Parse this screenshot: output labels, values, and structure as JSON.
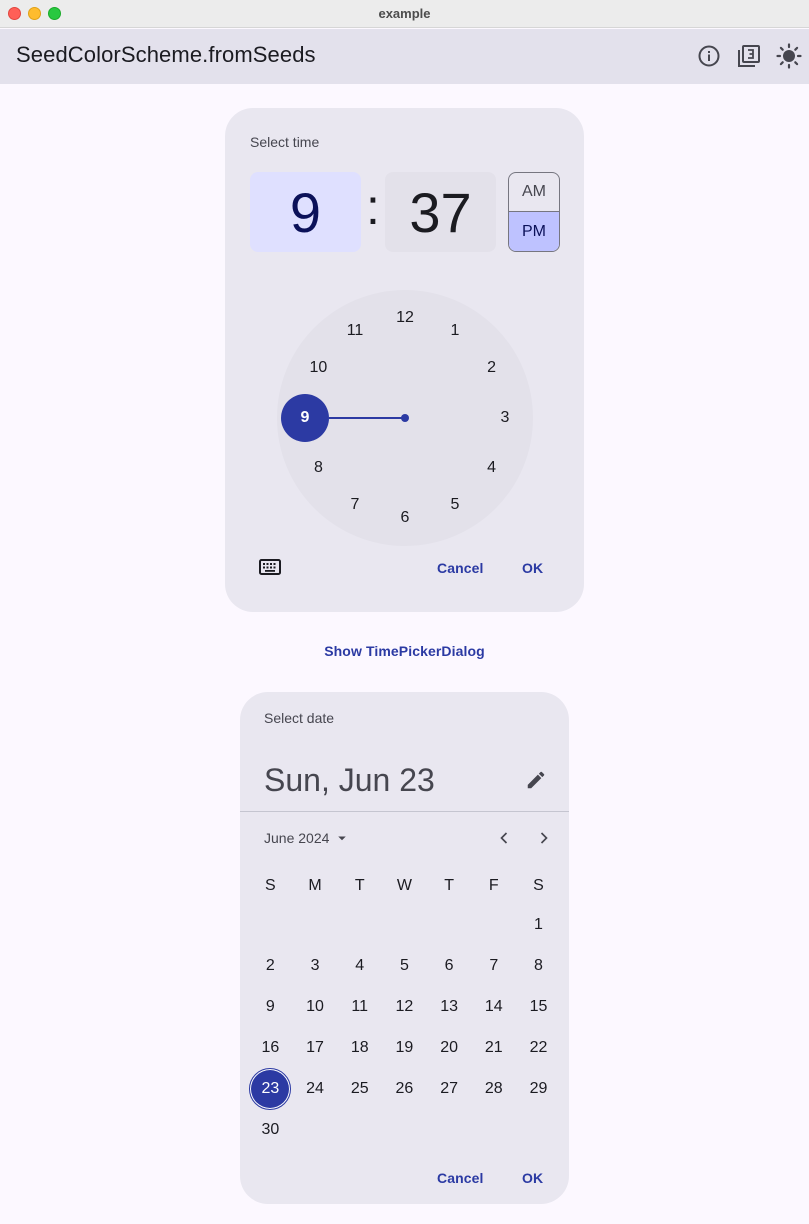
{
  "window": {
    "title": "example"
  },
  "appbar": {
    "title": "SeedColorScheme.fromSeeds",
    "actions": [
      "info-icon",
      "filter-3-icon",
      "brightness-icon"
    ]
  },
  "time_picker": {
    "label": "Select time",
    "hour": "9",
    "separator": ":",
    "minute": "37",
    "am": "AM",
    "pm": "PM",
    "period_selected": "PM",
    "dial": [
      "12",
      "1",
      "2",
      "3",
      "4",
      "5",
      "6",
      "7",
      "8",
      "9",
      "10",
      "11"
    ],
    "selected_hour": "9",
    "cancel": "Cancel",
    "ok": "OK"
  },
  "show_time_picker": "Show TimePickerDialog",
  "date_picker": {
    "label": "Select date",
    "headline": "Sun, Jun 23",
    "month": "June 2024",
    "weekdays": [
      "S",
      "M",
      "T",
      "W",
      "T",
      "F",
      "S"
    ],
    "weeks": [
      [
        "",
        "",
        "",
        "",
        "",
        "",
        "1"
      ],
      [
        "2",
        "3",
        "4",
        "5",
        "6",
        "7",
        "8"
      ],
      [
        "9",
        "10",
        "11",
        "12",
        "13",
        "14",
        "15"
      ],
      [
        "16",
        "17",
        "18",
        "19",
        "20",
        "21",
        "22"
      ],
      [
        "23",
        "24",
        "25",
        "26",
        "27",
        "28",
        "29"
      ],
      [
        "30",
        "",
        "",
        "",
        "",
        "",
        ""
      ]
    ],
    "selected_day": "23",
    "cancel": "Cancel",
    "ok": "OK"
  },
  "colors": {
    "primary": "#2c3aa3",
    "primary_container": "#dfe0ff",
    "surface": "#fcf8ff",
    "surface_container": "#e9e7f0"
  }
}
